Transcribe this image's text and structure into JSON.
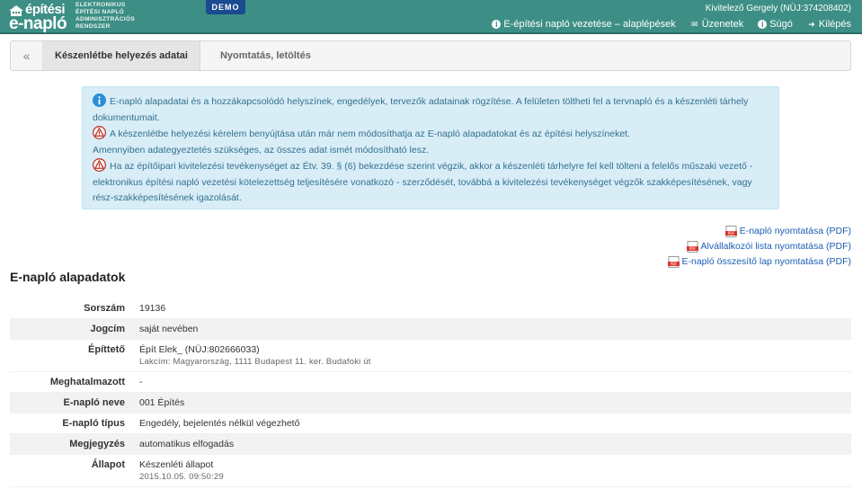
{
  "header": {
    "logo_line1": "építési",
    "logo_line2": "e-napló",
    "logo_subtitle": [
      "ELEKTRONIKUS",
      "ÉPÍTÉSI NAPLÓ",
      "ADMINISZTRÁCIÓS",
      "RENDSZER"
    ],
    "demo_badge": "DEMO",
    "user": "Kivitelező Gergely (NÜJ:374208402)",
    "nav": [
      {
        "icon": "info-icon",
        "label": "E-építési napló vezetése – alaplépések"
      },
      {
        "icon": "envelope-icon",
        "label": "Üzenetek"
      },
      {
        "icon": "info-icon",
        "label": "Súgó"
      },
      {
        "icon": "logout-icon",
        "label": "Kilépés"
      }
    ],
    "colors": {
      "bar": "#3d8f85",
      "demo": "#1a4a8f"
    }
  },
  "tabs": {
    "back": "«",
    "items": [
      "Készenlétbe helyezés adatai",
      "Nyomtatás, letöltés"
    ]
  },
  "infobox": {
    "p1": "E-napló alapadatai és a hozzákapcsolódó helyszínek, engedélyek, tervezők adatainak rögzítése. A felületen töltheti fel a tervnapló és a készenléti tárhely dokumentumait.",
    "p2": "A készenlétbe helyezési kérelem benyújtása után már nem módosíthatja az E-napló alapadatokat és az építési helyszíneket.",
    "p3": "Amennyiben adategyeztetés szükséges, az összes adat ismét módosítható lesz.",
    "p4": "Ha az építőipari kivitelezési tevékenységet az Étv. 39. § (6) bekezdése szerint végzik, akkor a készenléti tárhelyre fel kell tölteni a felelős műszaki vezető - elektronikus építési napló vezetési kötelezettség teljesítésére vonatkozó - szerződését, továbbá a kivitelezési tevékenységet végzők szakképesítésének, vagy rész-szakképesítésének igazolását."
  },
  "pdf_links": [
    "E-napló nyomtatása (PDF)",
    "Alvállalkozói lista nyomtatása (PDF)",
    "E-napló összesítő lap nyomtatása (PDF)"
  ],
  "section_title": "E-napló alapadatok",
  "rows": [
    {
      "label": "Sorszám",
      "value": "19136",
      "sub": ""
    },
    {
      "label": "Jogcím",
      "value": "saját nevében",
      "sub": ""
    },
    {
      "label": "Építtető",
      "value": "Épít Elek_ (NÜJ:802666033)",
      "sub": "Lakcím: Magyarország, 1111 Budapest 11. ker. Budafoki út"
    },
    {
      "label": "Meghatalmazott",
      "value": "-",
      "sub": ""
    },
    {
      "label": "E-napló neve",
      "value": "001 Építés",
      "sub": ""
    },
    {
      "label": "E-napló típus",
      "value": "Engedély, bejelentés nélkül végezhető",
      "sub": ""
    },
    {
      "label": "Megjegyzés",
      "value": "automatikus elfogadás",
      "sub": ""
    },
    {
      "label": "Állapot",
      "value": "Készenléti állapot",
      "sub": "2015.10.05. 09:50:29"
    }
  ]
}
